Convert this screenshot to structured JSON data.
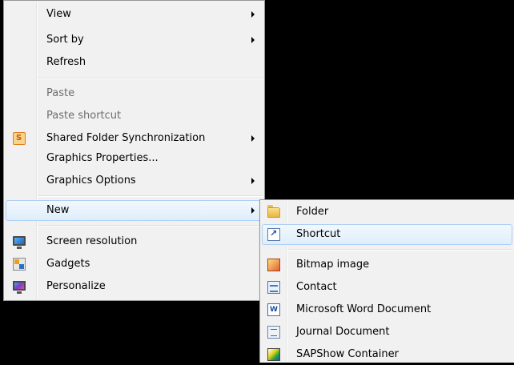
{
  "main_menu": {
    "items": [
      {
        "label": "View",
        "submenu": true
      },
      {
        "label": "Sort by",
        "submenu": true
      },
      {
        "label": "Refresh"
      },
      {
        "label": "Paste",
        "disabled": true
      },
      {
        "label": "Paste shortcut",
        "disabled": true
      },
      {
        "label": "Shared Folder Synchronization",
        "submenu": true,
        "icon": "shared-folder-sync-icon"
      },
      {
        "label": "Graphics Properties..."
      },
      {
        "label": "Graphics Options",
        "submenu": true
      },
      {
        "label": "New",
        "submenu": true,
        "highlighted": true
      },
      {
        "label": "Screen resolution",
        "icon": "screen-resolution-icon"
      },
      {
        "label": "Gadgets",
        "icon": "gadgets-icon"
      },
      {
        "label": "Personalize",
        "icon": "personalize-icon"
      }
    ]
  },
  "new_submenu": {
    "items": [
      {
        "label": "Folder",
        "icon": "folder-icon"
      },
      {
        "label": "Shortcut",
        "icon": "shortcut-icon",
        "highlighted": true
      },
      {
        "label": "Bitmap image",
        "icon": "bitmap-icon"
      },
      {
        "label": "Contact",
        "icon": "contact-icon"
      },
      {
        "label": "Microsoft Word Document",
        "icon": "word-document-icon"
      },
      {
        "label": "Journal Document",
        "icon": "journal-document-icon"
      },
      {
        "label": "SAPShow Container",
        "icon": "sapshow-icon"
      }
    ]
  },
  "colors": {
    "desktop_background": "#000000",
    "menu_background": "#f1f1f1",
    "highlight_border": "#aecff7",
    "disabled_text": "#6d6d6d"
  }
}
